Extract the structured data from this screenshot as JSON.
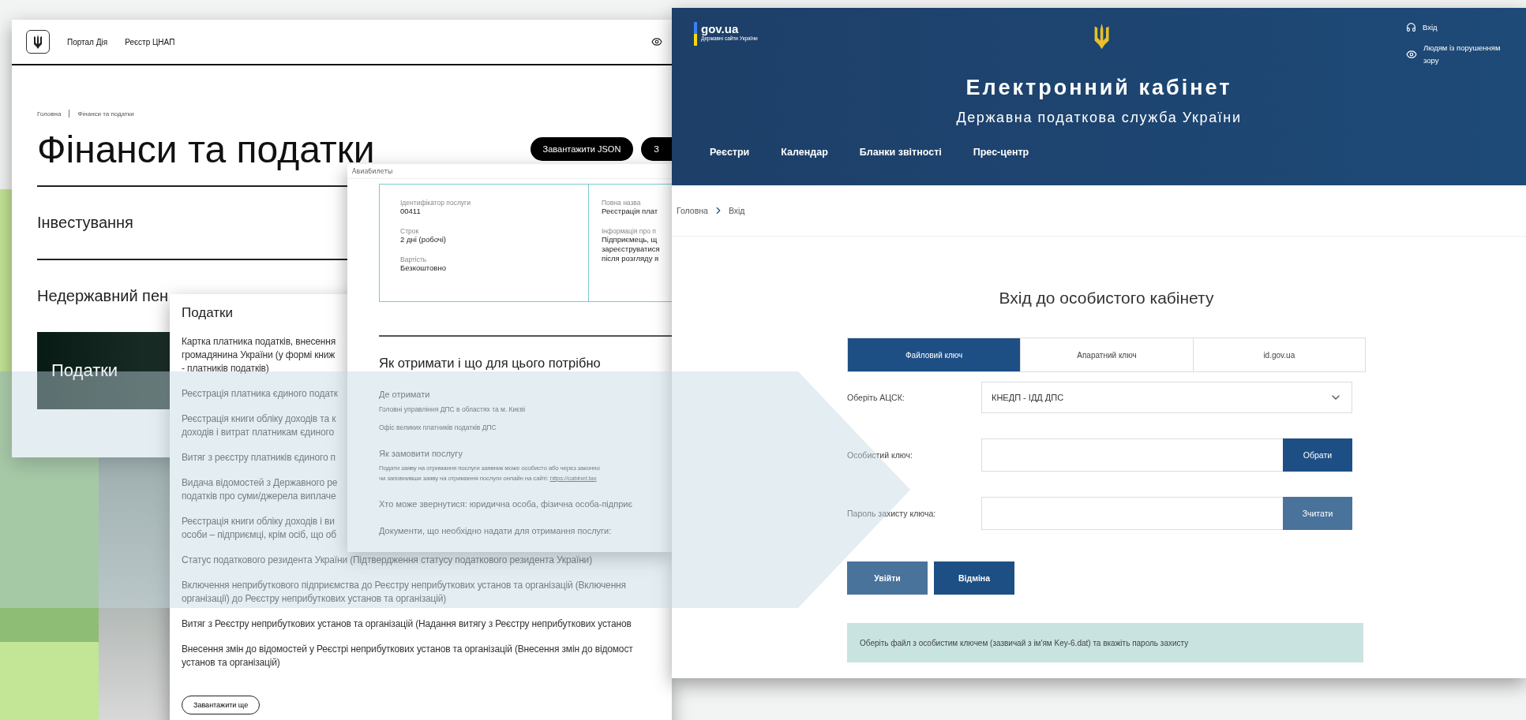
{
  "portal_window": {
    "nav": [
      "Портал Дія",
      "Реєстр ЦНАП"
    ],
    "breadcrumb": [
      "Головна",
      "Фінанси та податки"
    ],
    "title": "Фінанси та податки",
    "buttons": [
      "Завантажити JSON",
      "З"
    ],
    "sections": [
      {
        "label": "Інвестування",
        "kind": "row"
      },
      {
        "label": "Недержавний пен",
        "kind": "row"
      },
      {
        "label": "Податки",
        "kind": "block"
      }
    ]
  },
  "service_window": {
    "tab_label": "Авиабилеты",
    "details_left": [
      {
        "label": "Ідентифікатор послуги",
        "value": "00411"
      },
      {
        "label": "Строк",
        "value": "2 дні (робочі)"
      },
      {
        "label": "Вартість",
        "value": "Безкоштовно"
      }
    ],
    "details_right": [
      {
        "label": "Повна назва",
        "value": [
          "Реєстрація плат"
        ]
      },
      {
        "label": "Інформація про п",
        "value": [
          "Підприємець, щ",
          "зареєструватися",
          "після розгляду я"
        ]
      }
    ],
    "heading": "Як отримати і що для цього потрібно",
    "where_title": "Де отримати",
    "where_items": [
      "Головні управління ДПС в областях та м. Києві",
      "Офіс великих платників податків ДПС"
    ],
    "order_title": "Як замовити послугу",
    "order_text": [
      "Подати заяву на отримання послуги заявник може особисто або через законно",
      "чи заповнивши заяву на отримання послуги онлайн на сайті:"
    ],
    "order_link": "https://cabinet.tax",
    "who": "Хто може звернутися: юридична особа, фізична особа-підприє",
    "documents": "Документи, що необхідно надати для отримання послуги:"
  },
  "taxes_window": {
    "title": "Податки",
    "items": [
      {
        "lines": [
          "Картка платника податків, внесення",
          "громадянина України (у формі книж",
          "- платників податків)"
        ]
      },
      {
        "lines": [
          "Реєстрація платника єдиного податк"
        ]
      },
      {
        "lines": [
          "Реєстрація книги обліку доходів та к",
          "доходів і витрат платникам єдиного"
        ]
      },
      {
        "lines": [
          "Витяг з реєстру платників єдиного п"
        ]
      },
      {
        "lines": [
          "Видача відомостей з Державного ре",
          "податків про суми/джерела виплаче"
        ]
      },
      {
        "lines": [
          "Реєстрація книги обліку доходів і ви",
          "особи – підприємці, крім осіб, що об"
        ]
      },
      {
        "lines": [
          "Статус податкового резидента України (Підтвердження статусу податкового резидента України)"
        ]
      },
      {
        "lines": [
          "Включення неприбуткового підприємства до Реєстру неприбуткових установ та організацій (Включення",
          "організації) до Реєстру неприбуткових установ та організацій)"
        ]
      },
      {
        "lines": [
          "Витяг з Реєстру неприбуткових установ та організацій (Надання витягу з Реєстру неприбуткових установ"
        ]
      },
      {
        "lines": [
          "Внесення змін до відомостей у Реєстрі неприбуткових установ та організацій (Внесення змін до відомост",
          "установ та організацій)"
        ]
      }
    ],
    "more_button": "Завантажити ще"
  },
  "cabinet_window": {
    "logo_name": "gov.ua",
    "logo_tagline": "Державні сайти України",
    "login_link": "Вхід",
    "accessibility_link": "Людям із порушенням зору",
    "title": "Електронний кабінет",
    "subtitle": "Державна податкова служба України",
    "nav": [
      "Реєстри",
      "Календар",
      "Бланки звітності",
      "Прес-центр"
    ],
    "breadcrumb": [
      "Головна",
      "Вхід"
    ],
    "form_title": "Вхід до особистого кабінету",
    "tabs": [
      {
        "label": "Файловий ключ",
        "selected": true
      },
      {
        "label": "Апаратний ключ",
        "selected": false
      },
      {
        "label": "id.gov.ua",
        "selected": false
      }
    ],
    "fields": [
      {
        "label": "Оберіть АЦСК:",
        "kind": "select",
        "value": "КНЕДП - ІДД ДПС"
      },
      {
        "label": "Особистий ключ:",
        "kind": "file",
        "button": {
          "label": "Обрати",
          "disabled": false
        }
      },
      {
        "label": "Пароль захисту ключа:",
        "kind": "password",
        "button": {
          "label": "Зчитати",
          "disabled": true
        }
      }
    ],
    "actions": [
      {
        "label": "Увійти",
        "disabled": true
      },
      {
        "label": "Відміна",
        "disabled": false
      }
    ],
    "hint": "Оберіть файл з особистим ключем (зазвичай з ім'ям Key-6.dat) та вкажіть пароль захисту"
  }
}
